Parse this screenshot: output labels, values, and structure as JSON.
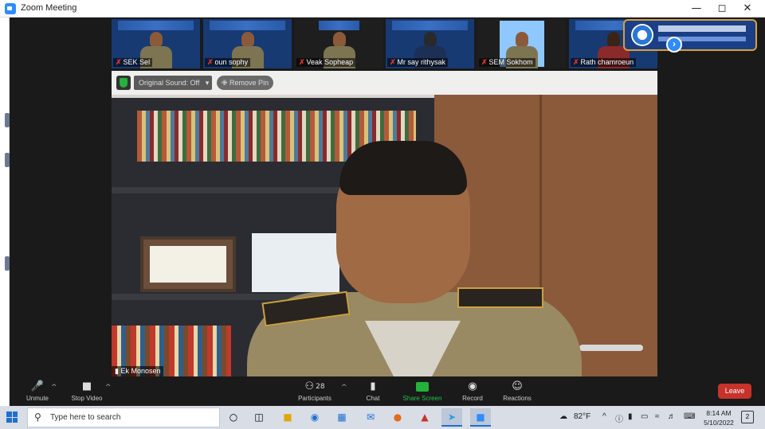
{
  "window": {
    "title": "Zoom Meeting"
  },
  "gallery": {
    "participants": [
      {
        "name": "SEK Sel"
      },
      {
        "name": "oun sophy"
      },
      {
        "name": "Veak Sopheap"
      },
      {
        "name": "Mr say rithysak"
      },
      {
        "name": "SEM  Sokhom"
      },
      {
        "name": "Rath chamroeun"
      }
    ]
  },
  "main_video": {
    "original_sound_label": "Original Sound: Off",
    "remove_pin_label": "Remove Pin",
    "speaker_name": "Ek Monosen"
  },
  "toolbar": {
    "unmute_label": "Unmute",
    "stop_video_label": "Stop Video",
    "participants_label": "Participants",
    "participants_count": "28",
    "chat_label": "Chat",
    "share_screen_label": "Share Screen",
    "record_label": "Record",
    "reactions_label": "Reactions",
    "leave_label": "Leave"
  },
  "taskbar": {
    "search_placeholder": "Type here to search",
    "weather": "82°F",
    "time": "8:14 AM",
    "date": "5/10/2022",
    "notification_count": "2"
  },
  "colors": {
    "zoom_blue": "#2d8cff",
    "share_green": "#23b33a",
    "leave_red": "#c7322b",
    "mic_off_red": "#e0342f"
  }
}
